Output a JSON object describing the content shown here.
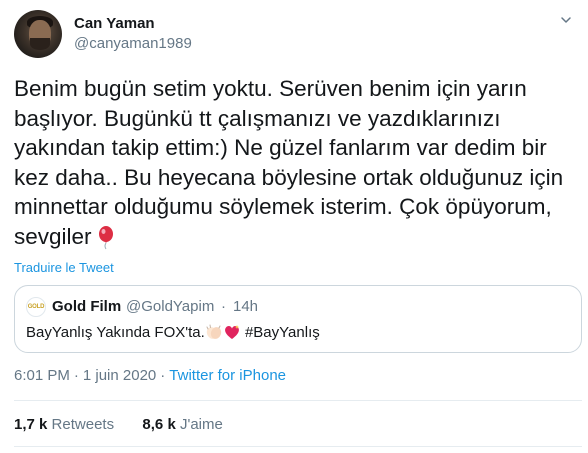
{
  "author": {
    "name": "Can Yaman",
    "handle": "@canyaman1989"
  },
  "tweet": {
    "text": "Benim bugün setim yoktu. Serüven benim için yarın\nbaşlıyor. Bugünkü tt çalışmanızı ve yazdıklarınızı\nyakından takip ettim:) Ne güzel fanlarım var dedim bir\nkez daha.. Bu heyecana böylesine ortak olduğunuz için\nminnettar olduğumu söylemek isterim. Çok öpüyorum,\nsevgiler",
    "translate_label": "Traduire le Tweet"
  },
  "quote": {
    "logo_text": "GOLD",
    "name": "Gold Film",
    "handle": "@GoldYapim",
    "dot": "·",
    "time": "14h",
    "text_before": "BayYanlış Yakında FOX'ta.",
    "text_after": " #BayYanlış"
  },
  "meta": {
    "time": "6:01 PM",
    "separator": "·",
    "date": "1 juin 2020",
    "source": "Twitter for iPhone"
  },
  "stats": {
    "retweets_count": "1,7 k",
    "retweets_label": "Retweets",
    "likes_count": "8,6 k",
    "likes_label": "J'aime"
  },
  "icons": {
    "header_menu": "chevron-down-icon",
    "balloon": "balloon-emoji",
    "clap": "clapping-hands-emoji",
    "heart": "sparkling-heart-emoji"
  },
  "colors": {
    "link": "#1b95e0",
    "muted": "#657786",
    "text": "#14171a",
    "border": "#ccd6dd"
  }
}
